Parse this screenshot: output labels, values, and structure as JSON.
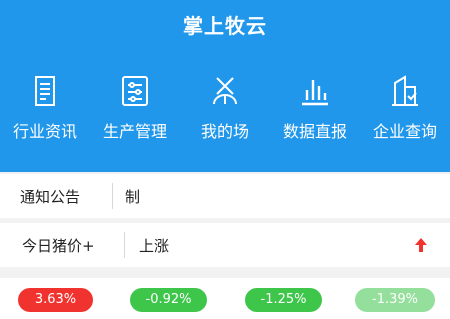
{
  "app": {
    "title": "掌上牧云"
  },
  "nav": {
    "items": [
      {
        "label": "行业资讯",
        "icon": "news-document-icon"
      },
      {
        "label": "生产管理",
        "icon": "production-settings-icon"
      },
      {
        "label": "我的场",
        "icon": "farm-icon"
      },
      {
        "label": "数据直报",
        "icon": "bar-chart-icon"
      },
      {
        "label": "企业查询",
        "icon": "enterprise-search-icon"
      }
    ]
  },
  "notice": {
    "label": "通知公告",
    "text": "制"
  },
  "price": {
    "label": "今日猪价+",
    "trend": "上涨",
    "trend_icon": "arrow-up-icon"
  },
  "changes": [
    {
      "value": "3.63%",
      "color": "#f0332f"
    },
    {
      "value": "-0.92%",
      "color": "#3ec64b"
    },
    {
      "value": "-1.25%",
      "color": "#3ec64b"
    },
    {
      "value": "-1.39%",
      "color": "#3ec64b"
    }
  ],
  "colors": {
    "header": "#2197ec",
    "up": "#f0332f",
    "down": "#3ec64b"
  }
}
